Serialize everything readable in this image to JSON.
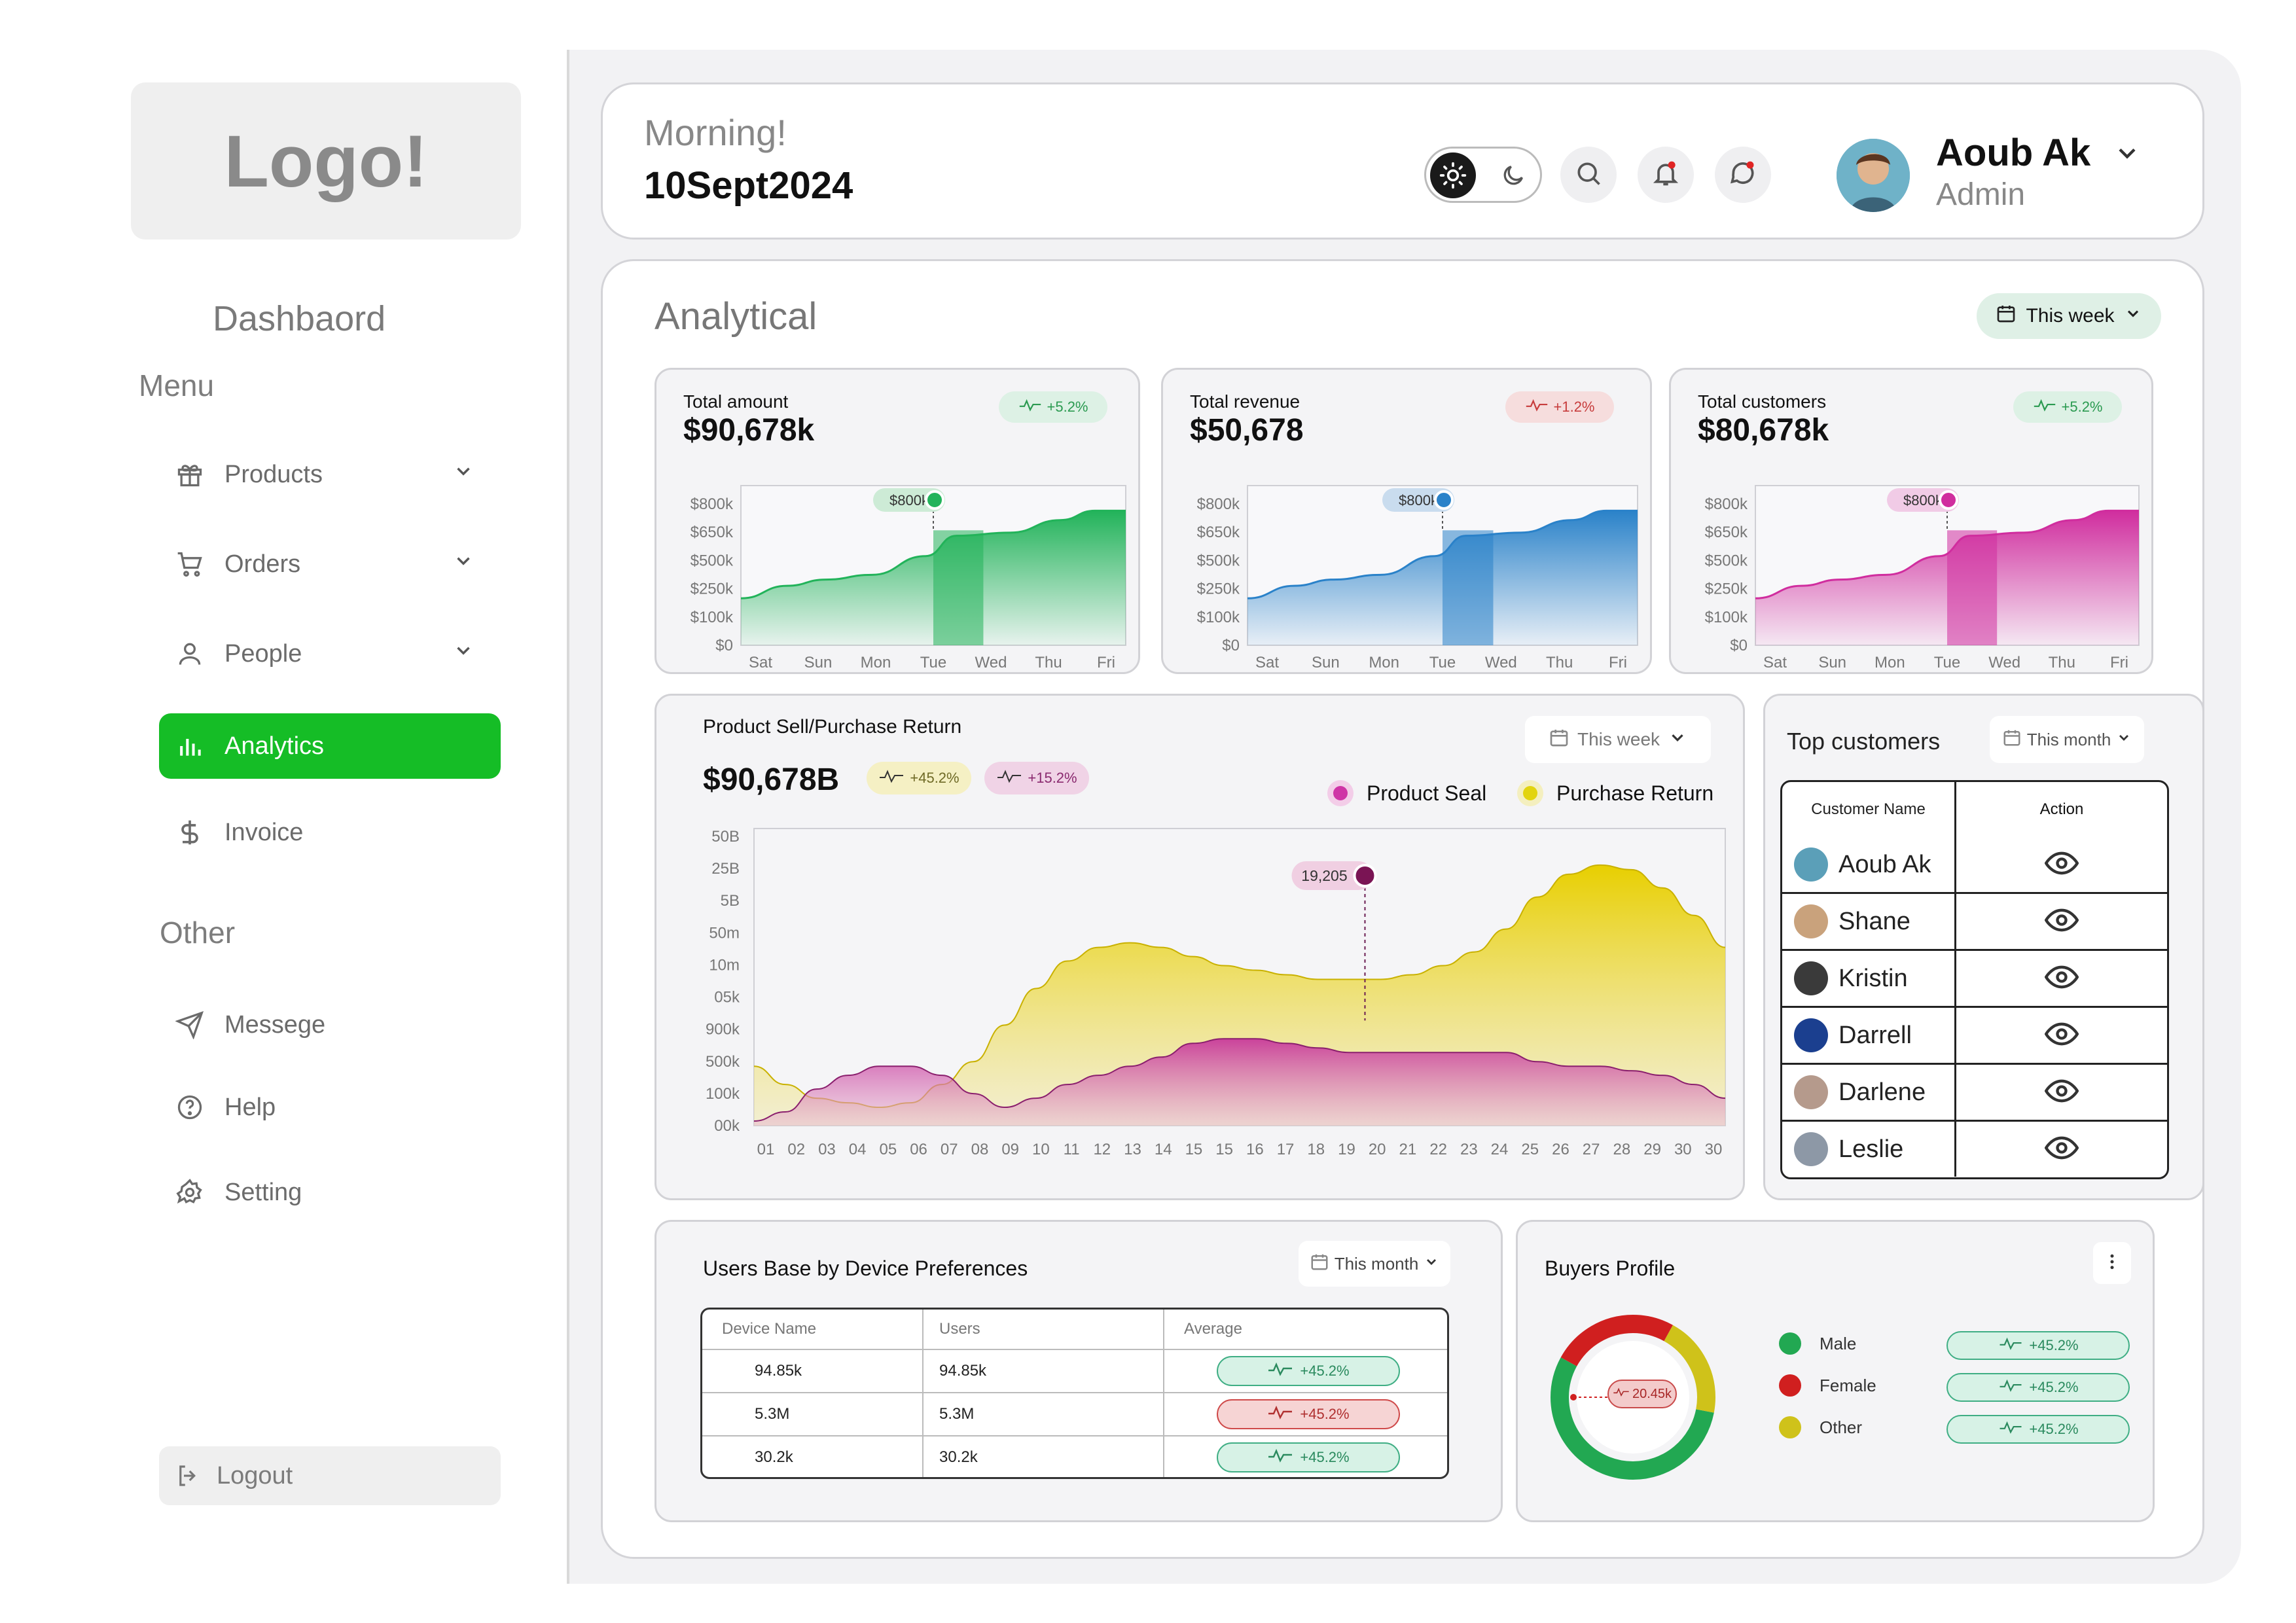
{
  "sidebar": {
    "logo": "Logo!",
    "title": "Dashbaord",
    "menu_label": "Menu",
    "menu_items": [
      {
        "label": "Products",
        "icon": "gift-icon"
      },
      {
        "label": "Orders",
        "icon": "cart-icon"
      },
      {
        "label": "People",
        "icon": "user-icon"
      },
      {
        "label": "Analytics",
        "icon": "bar-chart-icon",
        "active": true
      },
      {
        "label": "Invoice",
        "icon": "dollar-icon"
      }
    ],
    "other_label": "Other",
    "other_items": [
      {
        "label": "Messege",
        "icon": "send-icon"
      },
      {
        "label": "Help",
        "icon": "help-icon"
      },
      {
        "label": "Setting",
        "icon": "gear-icon"
      }
    ],
    "logout": "Logout"
  },
  "header": {
    "greeting": "Morning!",
    "date": "10Sept2024",
    "user_name": "Aoub Ak",
    "user_role": "Admin"
  },
  "analytical": {
    "title": "Analytical",
    "period": "This week"
  },
  "stats": [
    {
      "label": "Total amount",
      "value": "$90,678k",
      "change": "+5.2%",
      "color": "#22b35a",
      "tag_bg": "#ddf1e5",
      "tag_fg": "#2a9a50",
      "marker": "$800k",
      "marker_bg": "#cdebd6"
    },
    {
      "label": "Total revenue",
      "value": "$50,678",
      "change": "+1.2%",
      "color": "#2a82c9",
      "tag_bg": "#f6dddd",
      "tag_fg": "#c73c3c",
      "marker": "$800k",
      "marker_bg": "#c9dcee"
    },
    {
      "label": "Total customers",
      "value": "$80,678k",
      "change": "+5.2%",
      "color": "#d02d9e",
      "tag_bg": "#ddf1e5",
      "tag_fg": "#2a9a50",
      "marker": "$800k",
      "marker_bg": "#f1cbe6"
    }
  ],
  "mini_chart_axis": {
    "y_ticks": [
      "$800k",
      "$650k",
      "$500k",
      "$250k",
      "$100k",
      "$0"
    ],
    "x_ticks": [
      "Sat",
      "Sun",
      "Mon",
      "Tue",
      "Wed",
      "Thu",
      "Fri"
    ]
  },
  "sell_return": {
    "title": "Product Sell/Purchase Return",
    "period": "This week",
    "value": "$90,678B",
    "tag1": "+45.2%",
    "tag2": "+15.2%",
    "legend_seal": "Product Seal",
    "legend_return": "Purchase Return",
    "marker": "19,205"
  },
  "chart_data": {
    "type": "area",
    "y_ticks": [
      "50B",
      "25B",
      "5B",
      "50m",
      "10m",
      "05k",
      "900k",
      "500k",
      "100k",
      "00k"
    ],
    "x": [
      "01",
      "02",
      "03",
      "04",
      "05",
      "06",
      "07",
      "08",
      "09",
      "10",
      "11",
      "12",
      "13",
      "14",
      "15",
      "15",
      "16",
      "17",
      "18",
      "19",
      "20",
      "21",
      "22",
      "23",
      "24",
      "25",
      "26",
      "27",
      "28",
      "29",
      "30",
      "30"
    ],
    "series": [
      {
        "name": "Purchase Return",
        "color": "#e8d200",
        "values": [
          1.3,
          0.9,
          0.6,
          0.5,
          0.4,
          0.5,
          0.9,
          1.4,
          2.2,
          3.0,
          3.6,
          3.9,
          4.0,
          3.9,
          3.7,
          3.5,
          3.4,
          3.3,
          3.2,
          3.2,
          3.2,
          3.3,
          3.5,
          3.8,
          4.3,
          5.0,
          5.5,
          5.7,
          5.6,
          5.2,
          4.6,
          3.9
        ]
      },
      {
        "name": "Product Seal",
        "color": "#c52c9b",
        "values": [
          0.1,
          0.3,
          0.8,
          1.1,
          1.3,
          1.3,
          1.1,
          0.7,
          0.4,
          0.6,
          0.9,
          1.1,
          1.3,
          1.5,
          1.8,
          1.9,
          1.9,
          1.8,
          1.7,
          1.6,
          1.6,
          1.6,
          1.6,
          1.6,
          1.6,
          1.4,
          1.3,
          1.3,
          1.2,
          1.1,
          0.9,
          0.6
        ]
      }
    ]
  },
  "top_customers": {
    "title": "Top customers",
    "period": "This month",
    "col_name": "Customer Name",
    "col_action": "Action",
    "rows": [
      {
        "name": "Aoub Ak",
        "color": "#5b9fb8"
      },
      {
        "name": "Shane",
        "color": "#c9a27c"
      },
      {
        "name": "Kristin",
        "color": "#3a3a3a"
      },
      {
        "name": "Darrell",
        "color": "#1b3f8f"
      },
      {
        "name": "Darlene",
        "color": "#b59a8c"
      },
      {
        "name": "Leslie",
        "color": "#8d98a6"
      }
    ]
  },
  "devices": {
    "title": "Users Base by Device Preferences",
    "period": "This month",
    "col_device": "Device Name",
    "col_users": "Users",
    "col_avg": "Average",
    "rows": [
      {
        "device": "94.85k",
        "users": "94.85k",
        "avg": "+45.2%",
        "bg": "#d7f2e6",
        "fg": "#2a8a5e",
        "border": "#3fae84"
      },
      {
        "device": "5.3M",
        "users": "5.3M",
        "avg": "+45.2%",
        "bg": "#f6d4d4",
        "fg": "#b03030",
        "border": "#cf4a4a"
      },
      {
        "device": "30.2k",
        "users": "30.2k",
        "avg": "+45.2%",
        "bg": "#d7f2e6",
        "fg": "#2a8a5e",
        "border": "#3fae84"
      }
    ]
  },
  "buyers": {
    "title": "Buyers Profile",
    "center_tag": "20.45k",
    "legend": [
      {
        "label": "Male",
        "color": "#22a852",
        "change": "+45.2%"
      },
      {
        "label": "Female",
        "color": "#d01f1f",
        "change": "+45.2%"
      },
      {
        "label": "Other",
        "color": "#cfc21a",
        "change": "+45.2%"
      }
    ]
  }
}
